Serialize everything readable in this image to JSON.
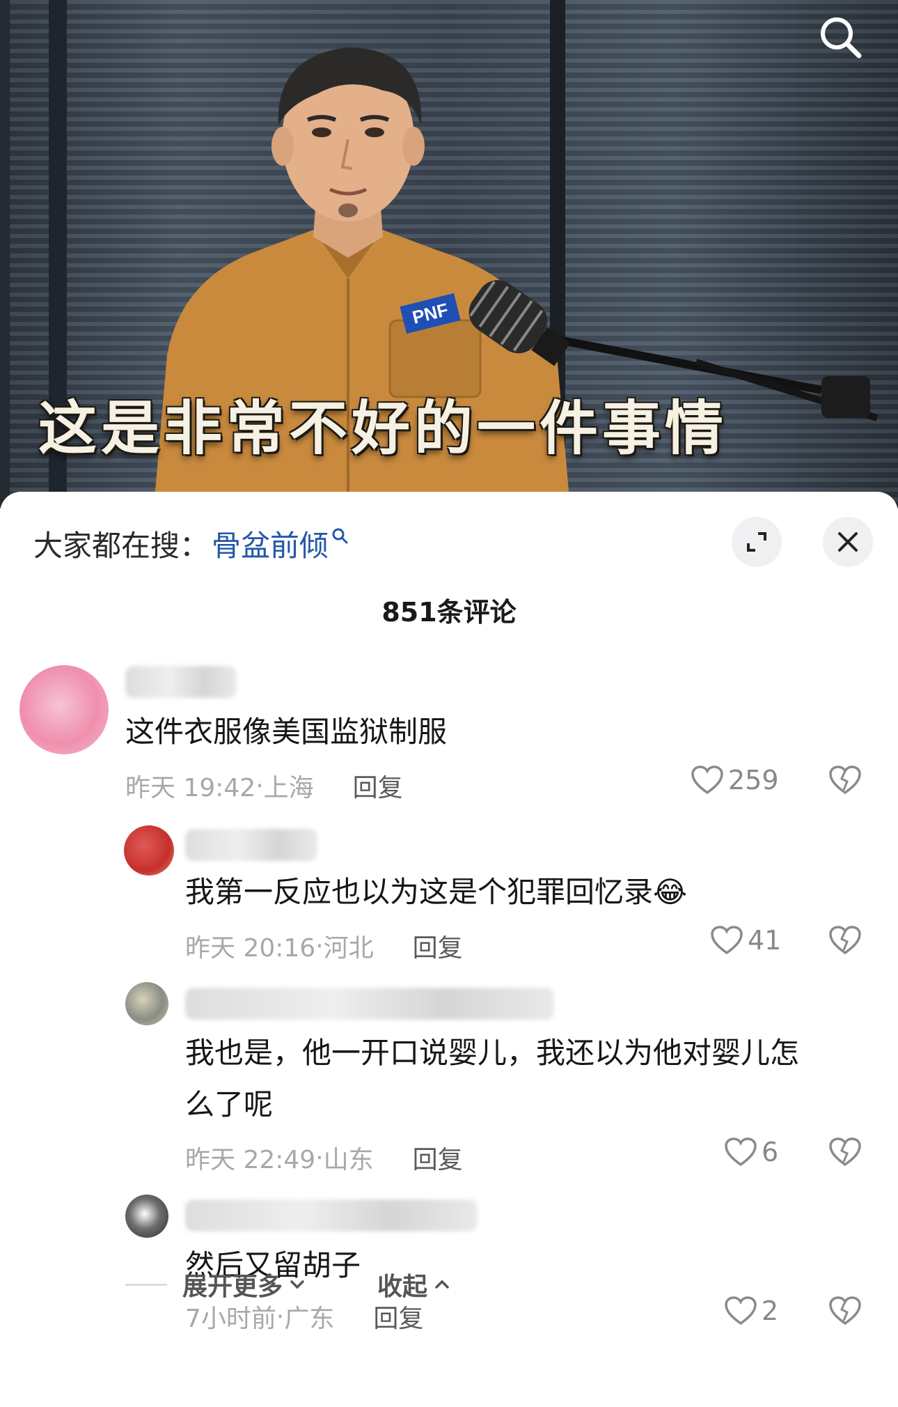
{
  "video": {
    "subtitle": "这是非常不好的一件事情",
    "shirt_badge": "PNF",
    "search_icon": "search-icon"
  },
  "sheet": {
    "hot_search_prefix": "大家都在搜：",
    "hot_search_term": "骨盆前倾",
    "hot_search_icon": "search-small-icon",
    "expand_icon": "expand-icon",
    "close_icon": "close-icon",
    "comment_count": "851条评论"
  },
  "comments": [
    {
      "text": "这件衣服像美国监狱制服",
      "time": "昨天 19:42",
      "location": "上海",
      "reply_label": "回复",
      "likes": "259"
    },
    {
      "text": "我第一反应也以为这是个犯罪回忆录",
      "emoji": "😂",
      "time": "昨天 20:16",
      "location": "河北",
      "reply_label": "回复",
      "likes": "41"
    },
    {
      "text_line1": "我也是，他一开口说婴儿，我还以为他对婴儿怎",
      "text_line2": "么了呢",
      "time": "昨天 22:49",
      "location": "山东",
      "reply_label": "回复",
      "likes": "6"
    },
    {
      "text": "然后又留胡子",
      "time": "7小时前",
      "location": "广东",
      "reply_label": "回复",
      "likes": "2"
    }
  ],
  "footer": {
    "expand_more": "展开更多",
    "collapse": "收起"
  },
  "colors": {
    "hot_term": "#2257a7",
    "meta_text": "#a8a8a8",
    "shirt": "#c98a3e"
  }
}
